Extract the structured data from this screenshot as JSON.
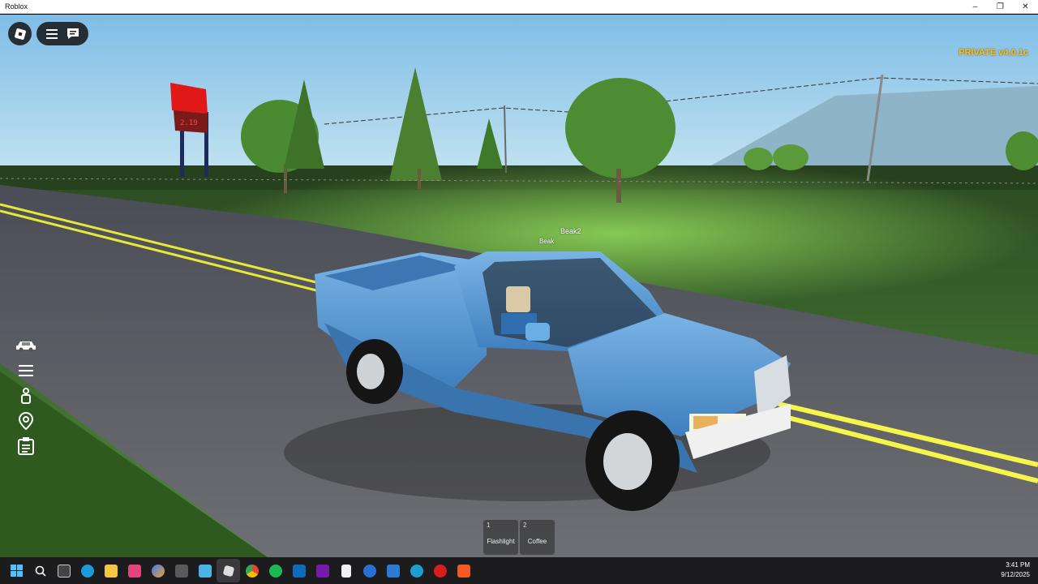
{
  "window": {
    "title": "Roblox",
    "controls": {
      "minimize": "–",
      "maximize": "❐",
      "close": "✕"
    }
  },
  "hud": {
    "version_label": "PRIVATE v4.0.1c",
    "player_tags": [
      "Beak2",
      "Beak"
    ],
    "sign_price": "2.19"
  },
  "roblox_menu": {
    "icons": [
      "roblox-logo-icon",
      "menu-icon",
      "chat-icon"
    ]
  },
  "side_menu": {
    "icons": [
      "car-icon",
      "list-icon",
      "person-icon",
      "map-pin-icon",
      "clipboard-icon"
    ]
  },
  "hotbar": {
    "slots": [
      {
        "number": "1",
        "label": "Flashlight"
      },
      {
        "number": "2",
        "label": "Coffee"
      }
    ]
  },
  "taskbar": {
    "apps": [
      "windows-start-icon",
      "search-icon",
      "task-view-icon",
      "edge-icon",
      "file-explorer-icon",
      "snipping-tool-icon",
      "copilot-icon",
      "calculator-icon",
      "notepad-icon",
      "roblox-icon",
      "chrome-icon",
      "spotify-icon",
      "outlook-icon",
      "onenote-icon",
      "file-icon",
      "app-blue-icon",
      "download-icon",
      "app-teal-icon",
      "opera-icon",
      "brave-icon"
    ],
    "time": "3:41 PM",
    "date": "9/12/2025"
  },
  "colors": {
    "truck": "#5b9ad6",
    "road_line": "#e8e83a",
    "grass": "#3f6a2e",
    "sky": "#a8d2ea",
    "version_text": "#f3c026"
  }
}
